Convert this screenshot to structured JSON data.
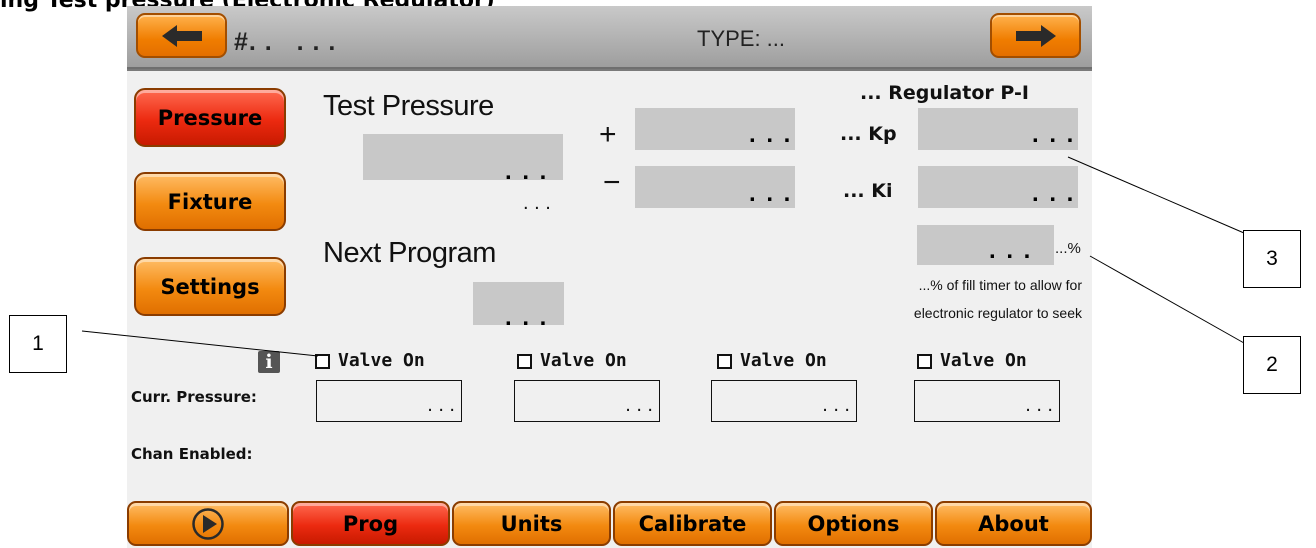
{
  "heading": "ing Test pressure (Electronic Regulator)",
  "topbar": {
    "id_text": "#. .   . . .",
    "type_text": "TYPE: ..."
  },
  "sidebar": {
    "items": [
      {
        "label": "Pressure",
        "active": true
      },
      {
        "label": "Fixture",
        "active": false
      },
      {
        "label": "Settings",
        "active": false
      }
    ]
  },
  "test_pressure": {
    "label": "Test Pressure",
    "value": ". . .",
    "unit": ". . .",
    "plus_sign": "+",
    "minus_sign": "−",
    "plus_value": ". . .",
    "minus_value": ". . ."
  },
  "regulator": {
    "title": "... Regulator P-I",
    "kp_label": "... Kp",
    "kp_value": ". . .",
    "ki_label": "... Ki",
    "ki_value": ". . .",
    "seek_value": ". . .",
    "seek_unit": "...%",
    "seek_description_line1": "...% of fill timer to allow for",
    "seek_description_line2": "electronic regulator to seek"
  },
  "next_program": {
    "label": "Next Program",
    "value": ". . ."
  },
  "channels": {
    "valve_labels": [
      "Valve On",
      "Valve On",
      "Valve On",
      "Valve On"
    ],
    "info_icon_text": "i",
    "curr_pressure_label": "Curr. Pressure:",
    "pressure_values": [
      ". . .",
      ". . .",
      ". . .",
      ". . ."
    ],
    "chan_enabled_label": "Chan Enabled:"
  },
  "bottom_nav": {
    "play_icon": "play-icon",
    "items": [
      {
        "label": "Prog",
        "active": true
      },
      {
        "label": "Units",
        "active": false
      },
      {
        "label": "Calibrate",
        "active": false
      },
      {
        "label": "Options",
        "active": false
      },
      {
        "label": "About",
        "active": false
      }
    ]
  },
  "callouts": [
    "1",
    "2",
    "3"
  ],
  "colors": {
    "orange_button": "#f38a10",
    "red_button": "#ec2a10",
    "screen_background": "#f0f0f0",
    "value_box": "#c8c8c8"
  }
}
